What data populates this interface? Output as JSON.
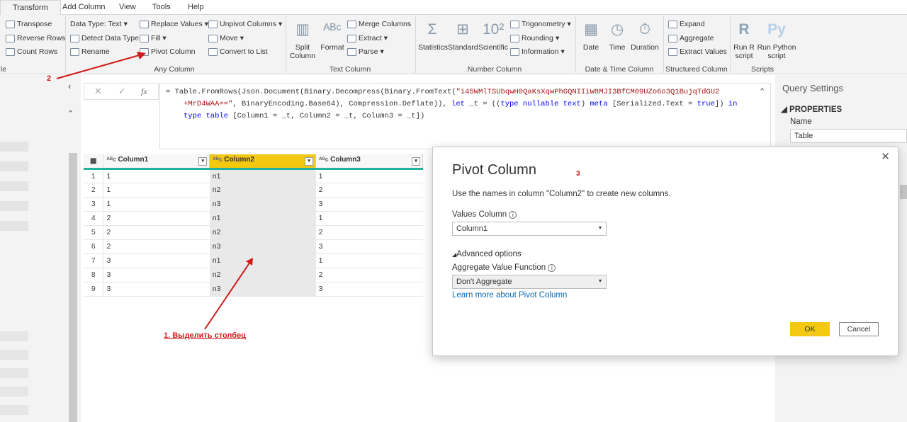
{
  "tabs": [
    "Transform",
    "Add Column",
    "View",
    "Tools",
    "Help"
  ],
  "ribbon": {
    "table": [
      "Transpose",
      "Reverse Rows",
      "Count Rows"
    ],
    "table_group_fragment": "le",
    "any": [
      "Data Type: Text",
      "Detect Data Type",
      "Rename",
      "Replace Values",
      "Fill",
      "Pivot Column",
      "Unpivot Columns",
      "Move",
      "Convert to List"
    ],
    "text": [
      "Split Column",
      "Format",
      "Merge Columns",
      "Extract",
      "Parse"
    ],
    "number": [
      "Statistics",
      "Standard",
      "Scientific",
      "Trigonometry",
      "Rounding",
      "Information"
    ],
    "datetime": [
      "Date",
      "Time",
      "Duration"
    ],
    "structured": [
      "Expand",
      "Aggregate",
      "Extract Values"
    ],
    "scripts": [
      "Run R script",
      "Run Python script"
    ],
    "groups": [
      "Any Column",
      "Text Column",
      "Number Column",
      "Date & Time Column",
      "Structured Column",
      "Scripts"
    ]
  },
  "formula": {
    "fx": "fx",
    "l1a": "= Table.FromRows(Json.Document(Binary.Decompress(Binary.FromText(",
    "l1s": "\"i45WMlTSUbqwH0QaKsXqwPhGQNIIiW8MJI3BfCM09UZo6o3Q1BujqTdGU2",
    "l2s": "+MrD4WAA==\"",
    "l2b": ", BinaryEncoding.Base64), Compression.Deflate)), ",
    "l2k1": "let",
    "l2c": " _t = ((",
    "l2k2": "type nullable text",
    "l2d": ") ",
    "l2k3": "meta",
    "l2e": " [Serialized.Text = ",
    "l2k4": "true",
    "l2f": "]) ",
    "l2k5": "in",
    "l3k": "type table",
    "l3": " [Column1 = _t, Column2 = _t, Column3 = _t])"
  },
  "table": {
    "headers": [
      "Column1",
      "Column2",
      "Column3"
    ],
    "rows": [
      [
        "1",
        "1",
        "n1",
        "1"
      ],
      [
        "2",
        "1",
        "n2",
        "2"
      ],
      [
        "3",
        "1",
        "n3",
        "3"
      ],
      [
        "4",
        "2",
        "n1",
        "1"
      ],
      [
        "5",
        "2",
        "n2",
        "2"
      ],
      [
        "6",
        "2",
        "n3",
        "3"
      ],
      [
        "7",
        "3",
        "n1",
        "1"
      ],
      [
        "8",
        "3",
        "n2",
        "2"
      ],
      [
        "9",
        "3",
        "n3",
        "3"
      ]
    ]
  },
  "query_settings": {
    "title": "Query Settings",
    "properties": "PROPERTIES",
    "name_label": "Name",
    "name_value": "Table"
  },
  "dialog": {
    "title": "Pivot Column",
    "desc": "Use the names in column \"Column2\" to create new columns.",
    "values_label": "Values Column",
    "values_value": "Column1",
    "advanced": "Advanced options",
    "agg_label": "Aggregate Value Function",
    "agg_value": "Don't Aggregate",
    "learn": "Learn more about Pivot Column",
    "ok": "OK",
    "cancel": "Cancel"
  },
  "annotations": {
    "a1": "1. Выделить столбец",
    "a2": "2",
    "a3": "3"
  },
  "colors": {
    "accent": "#f2c811",
    "teal": "#21b19e",
    "annotation": "#d01a1a"
  }
}
